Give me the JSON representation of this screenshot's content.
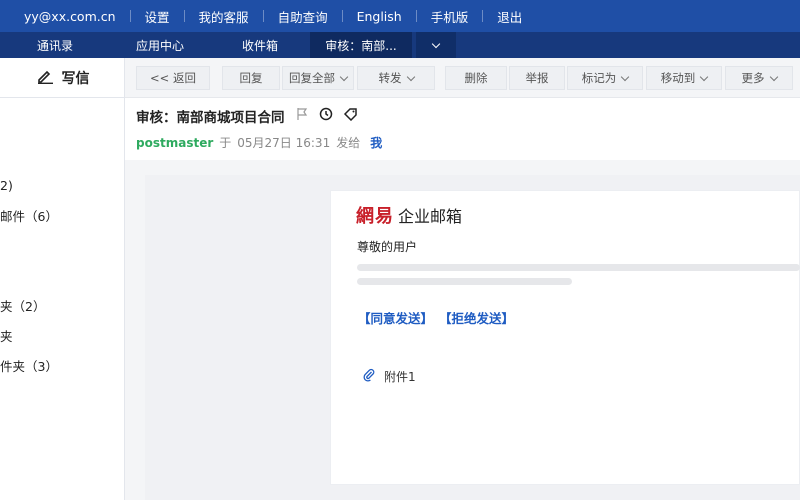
{
  "topbar": {
    "account": "yy@xx.com.cn",
    "links": [
      "设置",
      "我的客服",
      "自助查询",
      "English",
      "手机版",
      "退出"
    ]
  },
  "tabs": {
    "items": [
      "通讯录",
      "应用中心",
      "收件箱"
    ],
    "active": "审核：南部..."
  },
  "sidebar": {
    "write_label": "写信",
    "items": [
      "2)",
      "邮件（6）",
      "夹（2）",
      "夹",
      "件夹（3）"
    ]
  },
  "toolbar": {
    "back": "<< 返回",
    "reply": "回复",
    "reply_all": "回复全部",
    "forward": "转发",
    "delete": "删除",
    "report": "举报",
    "mark_as": "标记为",
    "move_to": "移动到",
    "more": "更多"
  },
  "mail": {
    "subject": "审核：南部商城项目合同",
    "sender": "postmaster",
    "at": "于",
    "date": "05月27日 16:31",
    "sent_to": "发给",
    "recipient": "我"
  },
  "body": {
    "logo": "網易",
    "brand_title": "企业邮箱",
    "greeting": "尊敬的用户",
    "agree_link": "【同意发送】",
    "reject_link": "【拒绝发送】",
    "attachment": "附件1"
  },
  "colors": {
    "topbar": "#1f4fa6",
    "tabbar": "#17397d",
    "link": "#1f5cc2",
    "sender": "#2eaa5f",
    "logo": "#c8202a"
  }
}
